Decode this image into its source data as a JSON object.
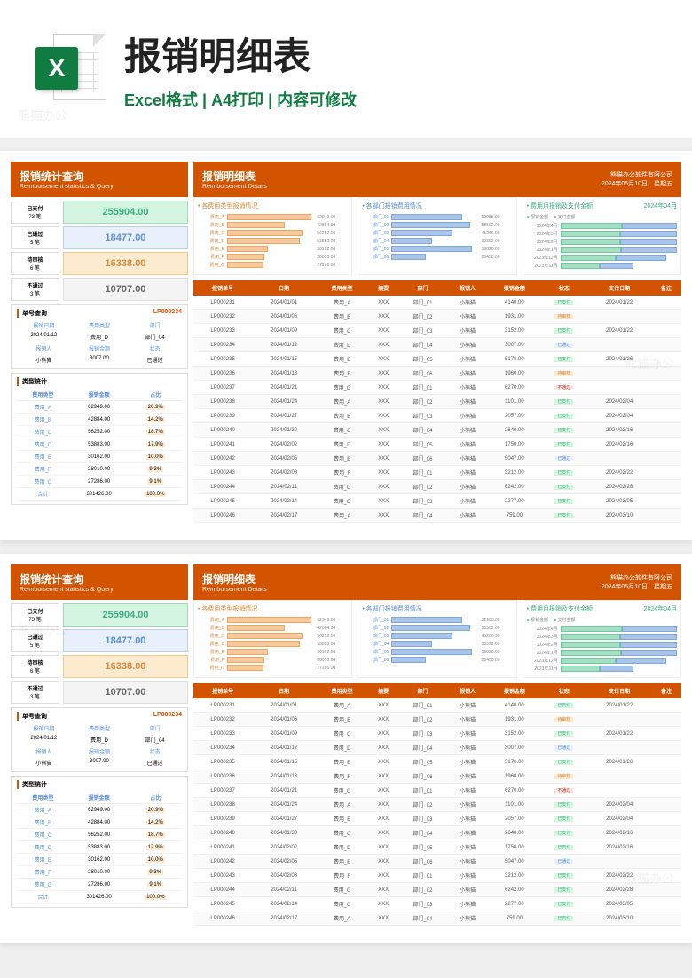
{
  "hero": {
    "title": "报销明细表",
    "subtitle": "Excel格式 | A4打印 | 内容可修改",
    "icon_letter": "X"
  },
  "header_left": {
    "title": "报销统计查询",
    "sub": "Reimbursement statistics & Query"
  },
  "header_right": {
    "title": "报销明细表",
    "sub": "Reimbursement Details",
    "company": "熊猫办公软件有限公司",
    "date": "2024年05月10日",
    "weekday": "星期五"
  },
  "kpis": [
    {
      "label": "已支付",
      "count": "73 笔",
      "value": "255904.00",
      "cls": "kpi-green"
    },
    {
      "label": "已通过",
      "count": "5 笔",
      "value": "18477.00",
      "cls": "kpi-blue"
    },
    {
      "label": "待审核",
      "count": "6 笔",
      "value": "16338.00",
      "cls": "kpi-orange"
    },
    {
      "label": "不通过",
      "count": "3 笔",
      "value": "10707.00",
      "cls": "kpi-gray"
    }
  ],
  "lookup": {
    "panel_title": "单号查询",
    "id": "LP000234",
    "h1": "报销日期",
    "h2": "费用类型",
    "h3": "部门",
    "v1": "2024/01/12",
    "v2": "费用_D",
    "v3": "部门_04",
    "h4": "报销人",
    "h5": "报销金额",
    "h6": "状态",
    "v4": "小熊猫",
    "v5": "3007.00",
    "v6": "已通过"
  },
  "type_stats": {
    "panel_title": "类型统计",
    "headers": [
      "费用类型",
      "报销金额",
      "占比"
    ],
    "rows": [
      [
        "费用_A",
        "62949.00",
        "20.9%"
      ],
      [
        "费用_B",
        "42884.00",
        "14.2%"
      ],
      [
        "费用_C",
        "56252.00",
        "18.7%"
      ],
      [
        "费用_D",
        "53883.00",
        "17.9%"
      ],
      [
        "费用_E",
        "30162.00",
        "10.0%"
      ],
      [
        "费用_F",
        "28010.00",
        "9.3%"
      ],
      [
        "费用_G",
        "27286.00",
        "9.1%"
      ],
      [
        "合计",
        "301426.00",
        "100.0%"
      ]
    ]
  },
  "chart_data": [
    {
      "type": "bar",
      "title": "• 各费用类型报销情况",
      "orientation": "horizontal",
      "color": "#f7c99b",
      "categories": [
        "费用_A",
        "费用_B",
        "费用_C",
        "费用_D",
        "费用_E",
        "费用_F",
        "费用_G"
      ],
      "values": [
        62949,
        42884,
        56252,
        53883,
        30162,
        28010,
        27286
      ],
      "xlim": [
        0,
        65000
      ]
    },
    {
      "type": "bar",
      "title": "• 各部门报销费用情况",
      "orientation": "horizontal",
      "color": "#aac5ea",
      "categories": [
        "部门_01",
        "部门_02",
        "部门_03",
        "部门_04",
        "部门_05",
        "部门_06"
      ],
      "values": [
        52988,
        58502,
        45266,
        30392,
        59820,
        25458
      ],
      "xlim": [
        0,
        65000
      ]
    },
    {
      "type": "bar",
      "title": "• 费用月报销及支付金额",
      "subtitle": "2024年04月",
      "orientation": "horizontal",
      "stacked": false,
      "categories": [
        "2024年4月",
        "2024年3月",
        "2024年2月",
        "2024年1月",
        "2023年12月",
        "2023年11月"
      ],
      "series": [
        {
          "name": "报销金额",
          "color": "#a5e0c5",
          "values": [
            43000,
            51000,
            62000,
            49000,
            31000,
            22000
          ]
        },
        {
          "name": "支付金额",
          "color": "#aac5ea",
          "values": [
            39000,
            48000,
            58000,
            45000,
            28000,
            19000
          ]
        }
      ],
      "xlim": [
        0,
        65000
      ]
    }
  ],
  "detail": {
    "headers": [
      "报销单号",
      "日期",
      "费用类型",
      "摘要",
      "部门",
      "报销人",
      "报销金额",
      "状态",
      "支付日期",
      "备注"
    ],
    "status_map": {
      "已支付": "st-paid",
      "已通过": "st-pass",
      "待审核": "st-wait",
      "不通过": "st-rej"
    },
    "rows": [
      [
        "LP000231",
        "2024/01/01",
        "费用_A",
        "XXX",
        "部门_01",
        "小熊猫",
        "4140.00",
        "已支付",
        "2024/01/22",
        ""
      ],
      [
        "LP000232",
        "2024/01/06",
        "费用_B",
        "XXX",
        "部门_02",
        "小熊猫",
        "1931.00",
        "待审核",
        "",
        ""
      ],
      [
        "LP000233",
        "2024/01/09",
        "费用_C",
        "XXX",
        "部门_03",
        "小熊猫",
        "3152.00",
        "已支付",
        "2024/01/22",
        ""
      ],
      [
        "LP000234",
        "2024/01/12",
        "费用_D",
        "XXX",
        "部门_04",
        "小熊猫",
        "3007.00",
        "已通过",
        "",
        ""
      ],
      [
        "LP000235",
        "2024/01/15",
        "费用_E",
        "XXX",
        "部门_05",
        "小熊猫",
        "5176.00",
        "已支付",
        "2024/01/26",
        ""
      ],
      [
        "LP000236",
        "2024/01/18",
        "费用_F",
        "XXX",
        "部门_06",
        "小熊猫",
        "1960.00",
        "待审核",
        "",
        ""
      ],
      [
        "LP000237",
        "2024/01/21",
        "费用_G",
        "XXX",
        "部门_01",
        "小熊猫",
        "6270.00",
        "不通过",
        "",
        ""
      ],
      [
        "LP000238",
        "2024/01/24",
        "费用_A",
        "XXX",
        "部门_02",
        "小熊猫",
        "1101.00",
        "已支付",
        "2024/02/04",
        ""
      ],
      [
        "LP000239",
        "2024/01/27",
        "费用_B",
        "XXX",
        "部门_03",
        "小熊猫",
        "2057.00",
        "已支付",
        "2024/02/04",
        ""
      ],
      [
        "LP000240",
        "2024/01/30",
        "费用_C",
        "XXX",
        "部门_04",
        "小熊猫",
        "2640.00",
        "已支付",
        "2024/02/16",
        ""
      ],
      [
        "LP000241",
        "2024/02/02",
        "费用_D",
        "XXX",
        "部门_05",
        "小熊猫",
        "1750.00",
        "已支付",
        "2024/02/16",
        ""
      ],
      [
        "LP000242",
        "2024/02/05",
        "费用_E",
        "XXX",
        "部门_06",
        "小熊猫",
        "5047.00",
        "已通过",
        "",
        ""
      ],
      [
        "LP000243",
        "2024/02/08",
        "费用_F",
        "XXX",
        "部门_01",
        "小熊猫",
        "3212.00",
        "已支付",
        "2024/02/22",
        ""
      ],
      [
        "LP000244",
        "2024/02/11",
        "费用_G",
        "XXX",
        "部门_02",
        "小熊猫",
        "6242.00",
        "已支付",
        "2024/02/28",
        ""
      ],
      [
        "LP000245",
        "2024/02/14",
        "费用_G",
        "XXX",
        "部门_03",
        "小熊猫",
        "2277.00",
        "已支付",
        "2024/03/05",
        ""
      ],
      [
        "LP000246",
        "2024/02/17",
        "费用_A",
        "XXX",
        "部门_04",
        "小熊猫",
        "759.00",
        "已支付",
        "2024/03/10",
        ""
      ]
    ]
  },
  "watermark": "熊猫办公"
}
